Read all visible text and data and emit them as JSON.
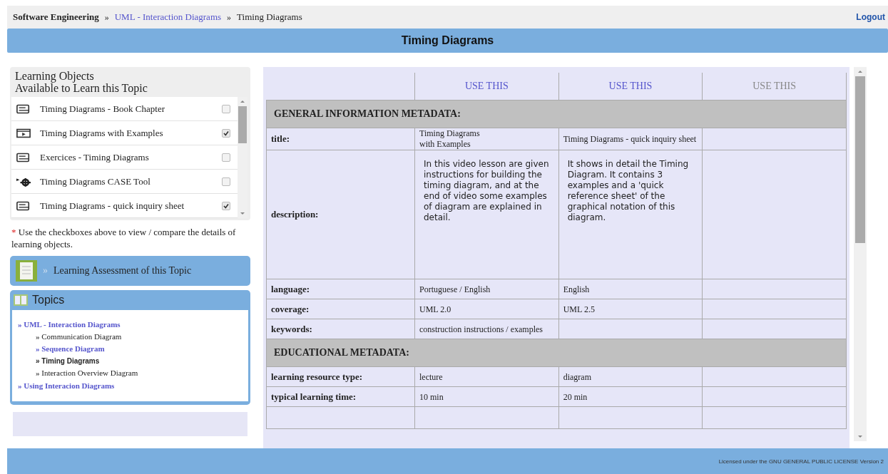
{
  "breadcrumb": [
    {
      "label": "Software Engineering",
      "kind": "root"
    },
    {
      "label": "UML - Interaction Diagrams",
      "kind": "link"
    },
    {
      "label": "Timing Diagrams",
      "kind": "current"
    }
  ],
  "separator": "»",
  "logout": "Logout",
  "page_title": "Timing Diagrams",
  "learning_objects": {
    "title": [
      "Learning Objects",
      "Available to Learn this Topic"
    ],
    "items": [
      {
        "label": "Timing Diagrams - Book Chapter",
        "kind": "document",
        "checked": false
      },
      {
        "label": "Timing Diagrams with Examples",
        "kind": "video",
        "checked": true
      },
      {
        "label": "Exercices - Timing Diagrams",
        "kind": "document",
        "checked": false
      },
      {
        "label": "Timing Diagrams CASE Tool",
        "kind": "tool",
        "checked": false
      },
      {
        "label": "Timing Diagrams - quick inquiry sheet",
        "kind": "document",
        "checked": true
      }
    ]
  },
  "note": {
    "mark": "*",
    "text": "Use the checkboxes above to view / compare the details of learning objects."
  },
  "assessment": {
    "arrow": "»",
    "label": "Learning Assessment of this Topic"
  },
  "topics": {
    "title": "Topics",
    "items": [
      {
        "label": "» UML - Interaction Diagrams",
        "kind": "link",
        "children": [
          {
            "label": "» Communication Diagram",
            "kind": "plain"
          },
          {
            "label": "» Sequence Diagram",
            "kind": "link"
          },
          {
            "label": "» Timing Diagrams",
            "kind": "current"
          },
          {
            "label": "» Interaction Overview Diagram",
            "kind": "plain"
          }
        ]
      },
      {
        "label": "» Using Interacion Diagrams",
        "kind": "link"
      }
    ]
  },
  "table": {
    "use_this": [
      {
        "label": "USE THIS",
        "disabled": false
      },
      {
        "label": "USE THIS",
        "disabled": false
      },
      {
        "label": "USE THIS",
        "disabled": true
      }
    ],
    "sections": [
      {
        "title": "GENERAL INFORMATION METADATA:",
        "rows": [
          {
            "label": "title:",
            "kind": "text",
            "values": [
              "Timing Diagrams\nwith Examples",
              "Timing Diagrams - quick inquiry sheet"
            ]
          },
          {
            "label": "description:",
            "kind": "description",
            "values": [
              "In this video lesson are given instructions for building the timing diagram, and at the end of video some examples of diagram are explained in detail.",
              "It shows in detail the Timing Diagram. It contains 3 examples and a 'quick reference sheet' of the graphical notation of this diagram."
            ]
          },
          {
            "label": "language:",
            "kind": "text",
            "values": [
              "Portuguese / English",
              "English"
            ]
          },
          {
            "label": "coverage:",
            "kind": "text",
            "values": [
              "UML 2.0",
              "UML 2.5"
            ]
          },
          {
            "label": "keywords:",
            "kind": "text",
            "values": [
              "construction instructions / examples"
            ]
          }
        ]
      },
      {
        "title": "EDUCATIONAL METADATA:",
        "rows": [
          {
            "label": "learning resource type:",
            "kind": "text",
            "values": [
              "lecture",
              "diagram"
            ]
          },
          {
            "label": "typical learning time:",
            "kind": "text",
            "values": [
              "10 min",
              "20 min"
            ]
          }
        ]
      }
    ]
  },
  "footer": "Licensed under the GNU GENERAL PUBLIC LICENSE Version 2"
}
